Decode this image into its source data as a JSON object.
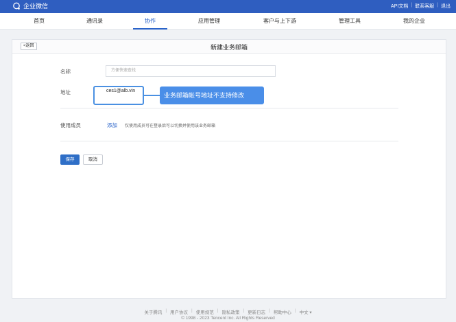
{
  "topbar": {
    "app_name": "企业微信",
    "links": [
      "API文档",
      "联系客服",
      "退出"
    ]
  },
  "nav": {
    "items": [
      "首页",
      "通讯录",
      "协作",
      "应用管理",
      "客户与上下游",
      "管理工具",
      "我的企业"
    ],
    "active_index": 2
  },
  "page": {
    "back_label": "<返回",
    "title": "新建业务邮箱"
  },
  "form": {
    "name_label": "名称",
    "name_placeholder": "方便快速查找",
    "address_label": "地址",
    "address_value": "ces1@alb.vin",
    "address_tooltip": "业务邮箱帐号地址不支持修改",
    "members_label": "使用成员",
    "add_label": "添加",
    "members_hint": "仅使用成员可在登录后可以切换并使用该业务邮箱",
    "save_label": "保存",
    "cancel_label": "取消"
  },
  "footer": {
    "links": [
      "关于腾讯",
      "用户协议",
      "使用规范",
      "隐私政策",
      "更新日志",
      "帮助中心",
      "中文 ▾"
    ],
    "copyright": "© 1998 - 2023 Tencent Inc. All Rights Reserved"
  },
  "colors": {
    "brand": "#2f5ec0",
    "accent": "#2a63c9",
    "tooltip": "#4a8ee8"
  }
}
